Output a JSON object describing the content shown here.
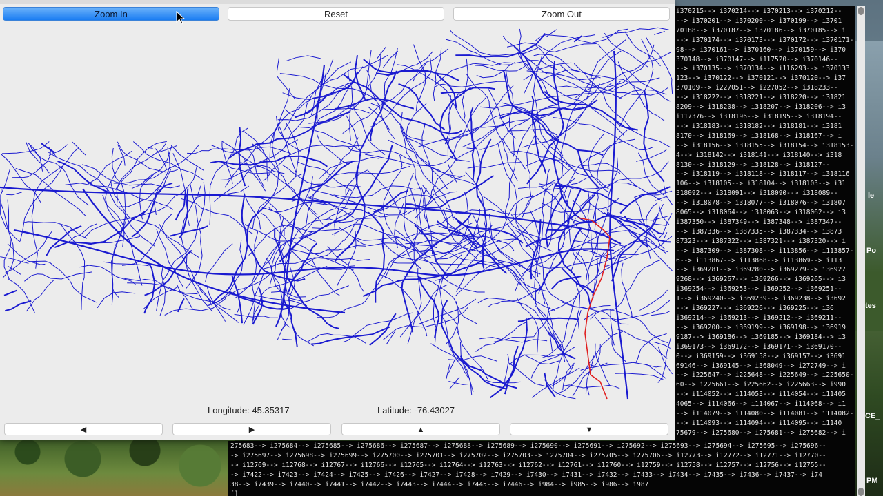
{
  "toolbar": {
    "zoom_in_label": "Zoom In",
    "reset_label": "Reset",
    "zoom_out_label": "Zoom Out"
  },
  "status": {
    "longitude": "Longitude: 45.35317",
    "latitude": "Latitude: -76.43027"
  },
  "nav": {
    "left": "◀",
    "right": "▶",
    "up": "▲",
    "down": "▼"
  },
  "colors": {
    "road": "#1a1ad0",
    "route": "#e02020",
    "accent": "#1a7cf2"
  },
  "desktop_labels": [
    "le",
    "Po",
    "tes",
    "CE_",
    "PM"
  ],
  "terminal_right_lines": [
    "i370215--> i370214--> i370213--> i370212--",
    "--> i370201--> i370200--> i370199--> i3701",
    "70188--> i370187--> i370186--> i370185--> i",
    "--> i370174--> i370173--> i370172--> i370171-",
    "98--> i370161--> i370160--> i370159--> i370",
    "370148--> i370147--> i117520--> i370146--",
    "--> i370135--> i370134--> i116293--> i370133",
    "123--> i370122--> i370121--> i370120--> i37",
    "370109--> i227051--> i227052--> i318233--",
    "--> i318222--> i318221--> i318220--> i31821",
    "8209--> i318208--> i318207--> i318206--> i3",
    "i117376--> i318196--> i318195--> i318194--",
    "--> i318183--> i318182--> i318181--> i3181",
    "8170--> i318169--> i318168--> i318167--> i",
    "--> i318156--> i318155--> i318154--> i318153-",
    "4--> i318142--> i318141--> i318140--> i318",
    "8130--> i318129--> i318128--> i318127--",
    "--> i318119--> i318118--> i318117--> i318116",
    "106--> i318105--> i318104--> i318103--> i31",
    "318092--> i318091--> i318090--> i318089--",
    "--> i318078--> i318077--> i318076--> i31807",
    "8065--> i318064--> i318063--> i318062--> i3",
    "i387350--> i387349--> i387348--> i387347--",
    "--> i387336--> i387335--> i387334--> i3873",
    "87323--> i387322--> i387321--> i387320--> i",
    "--> i387309--> i387308--> i113856--> i113857-",
    "6--> i113867--> i113868--> i113869--> i113",
    "--> i369281--> i369280--> i369279--> i36927",
    "9268--> i369267--> i369266--> i369265--> i3",
    "i369254--> i369253--> i369252--> i369251--",
    "1--> i369240--> i369239--> i369238--> i3692",
    "--> i369227--> i369226--> i369225--> i36",
    "i369214--> i369213--> i369212--> i369211--",
    "--> i369200--> i369199--> i369198--> i36919",
    "9187--> i369186--> i369185--> i369184--> i3",
    "i369173--> i369172--> i369171--> i369170--",
    "0--> i369159--> i369158--> i369157--> i3691",
    "69146--> i369145--> i368049--> i272749--> i",
    "--> i225647--> i225648--> i225649--> i225650-",
    "60--> i225661--> i225662--> i225663--> i990",
    "--> i114052--> i114053--> i114054--> i11405",
    "4065--> i114066--> i114067--> i114068--> i1",
    "--> i114079--> i114080--> i114081--> i114082--",
    "--> i114093--> i114094--> i114095--> i1140",
    "75679--> i275680--> i275681--> i275682--> i"
  ],
  "terminal_bottom_lines": [
    "275683--> i275684--> i275685--> i275686--> i275687--> i275688--> i275689--> i275690--> i275691--> i275692--> i275693--> i275694--> i275695--> i275696--",
    "-> i275697--> i275698--> i275699--> i275700--> i275701--> i275702--> i275703--> i275704--> i275705--> i275706--> i12773--> i12772--> i12771--> i12770--",
    "-> i12769--> i12768--> i12767--> i12766--> i12765--> i12764--> i12763--> i12762--> i12761--> i12760--> i12759--> i12758--> i12757--> i12756--> i12755--",
    "-> i7422--> i7423--> i7424--> i7425--> i7426--> i7427--> i7428--> i7429--> i7430--> i7431--> i7432--> i7433--> i7434--> i7435--> i7436--> i7437--> i74",
    "38--> i7439--> i7440--> i7441--> i7442--> i7443--> i7444--> i7445--> i7446--> i984--> i985--> i986--> i987",
    "[]"
  ]
}
